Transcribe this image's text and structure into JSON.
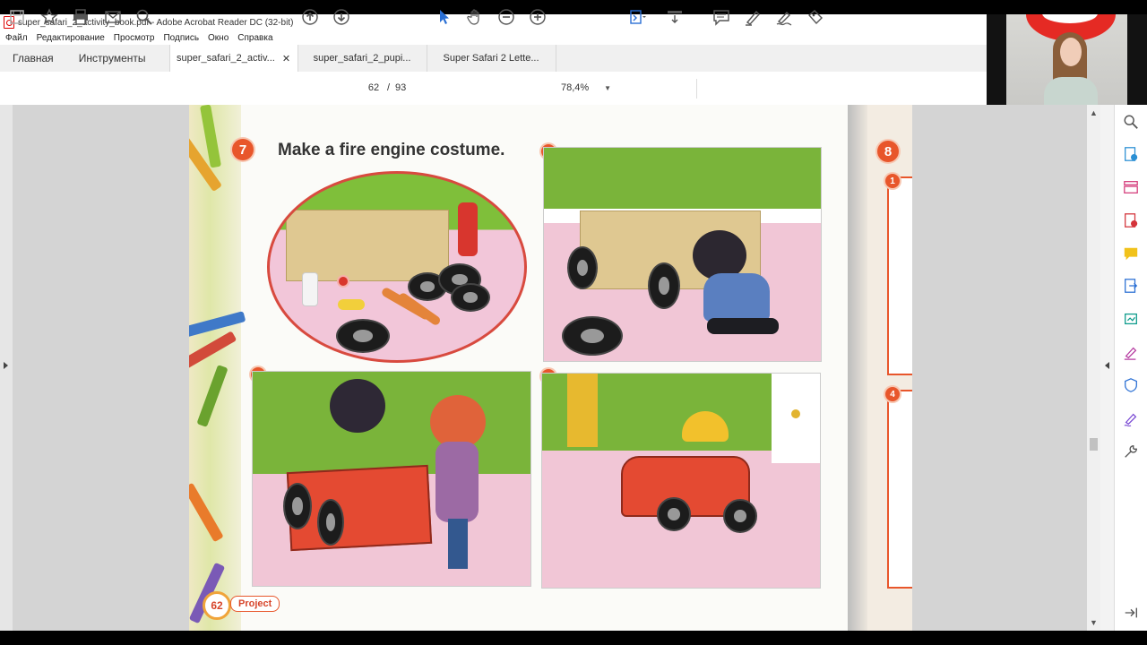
{
  "window": {
    "title": "super_safari_2_activity_book.pdf - Adobe Acrobat Reader DC (32-bit)"
  },
  "menu": {
    "items": [
      "Файл",
      "Редактирование",
      "Просмотр",
      "Подпись",
      "Окно",
      "Справка"
    ]
  },
  "tabs": {
    "home": "Главная",
    "tools": "Инструменты",
    "docs": [
      {
        "label": "super_safari_2_activ...",
        "active": true
      },
      {
        "label": "super_safari_2_pupi...",
        "active": false
      },
      {
        "label": "Super Safari 2 Lette...",
        "active": false
      }
    ]
  },
  "toolbar": {
    "page_current": "62",
    "page_separator": "/",
    "page_total": "93",
    "zoom": "78,4%",
    "icons": [
      "save-icon",
      "bookmark-star-icon",
      "print-icon",
      "email-icon",
      "find-icon",
      "prev-page-icon",
      "next-page-icon",
      "select-cursor-icon",
      "hand-pan-icon",
      "zoom-out-icon",
      "zoom-in-icon",
      "fit-page-icon",
      "scroll-mode-icon",
      "comment-icon",
      "highlight-pen-icon",
      "sign-icon",
      "fill-sign-icon"
    ]
  },
  "page": {
    "activity_number": "7",
    "title": "Make a fire engine costume.",
    "steps": [
      "1",
      "2",
      "3"
    ],
    "footer_page": "62",
    "footer_label": "Project"
  },
  "next_page": {
    "activity_number": "8",
    "steps": [
      "1",
      "4"
    ]
  },
  "colors": {
    "accent": "#e8562b",
    "acrobat_red": "#d00000",
    "panel_bg": "#d4d4d4"
  }
}
